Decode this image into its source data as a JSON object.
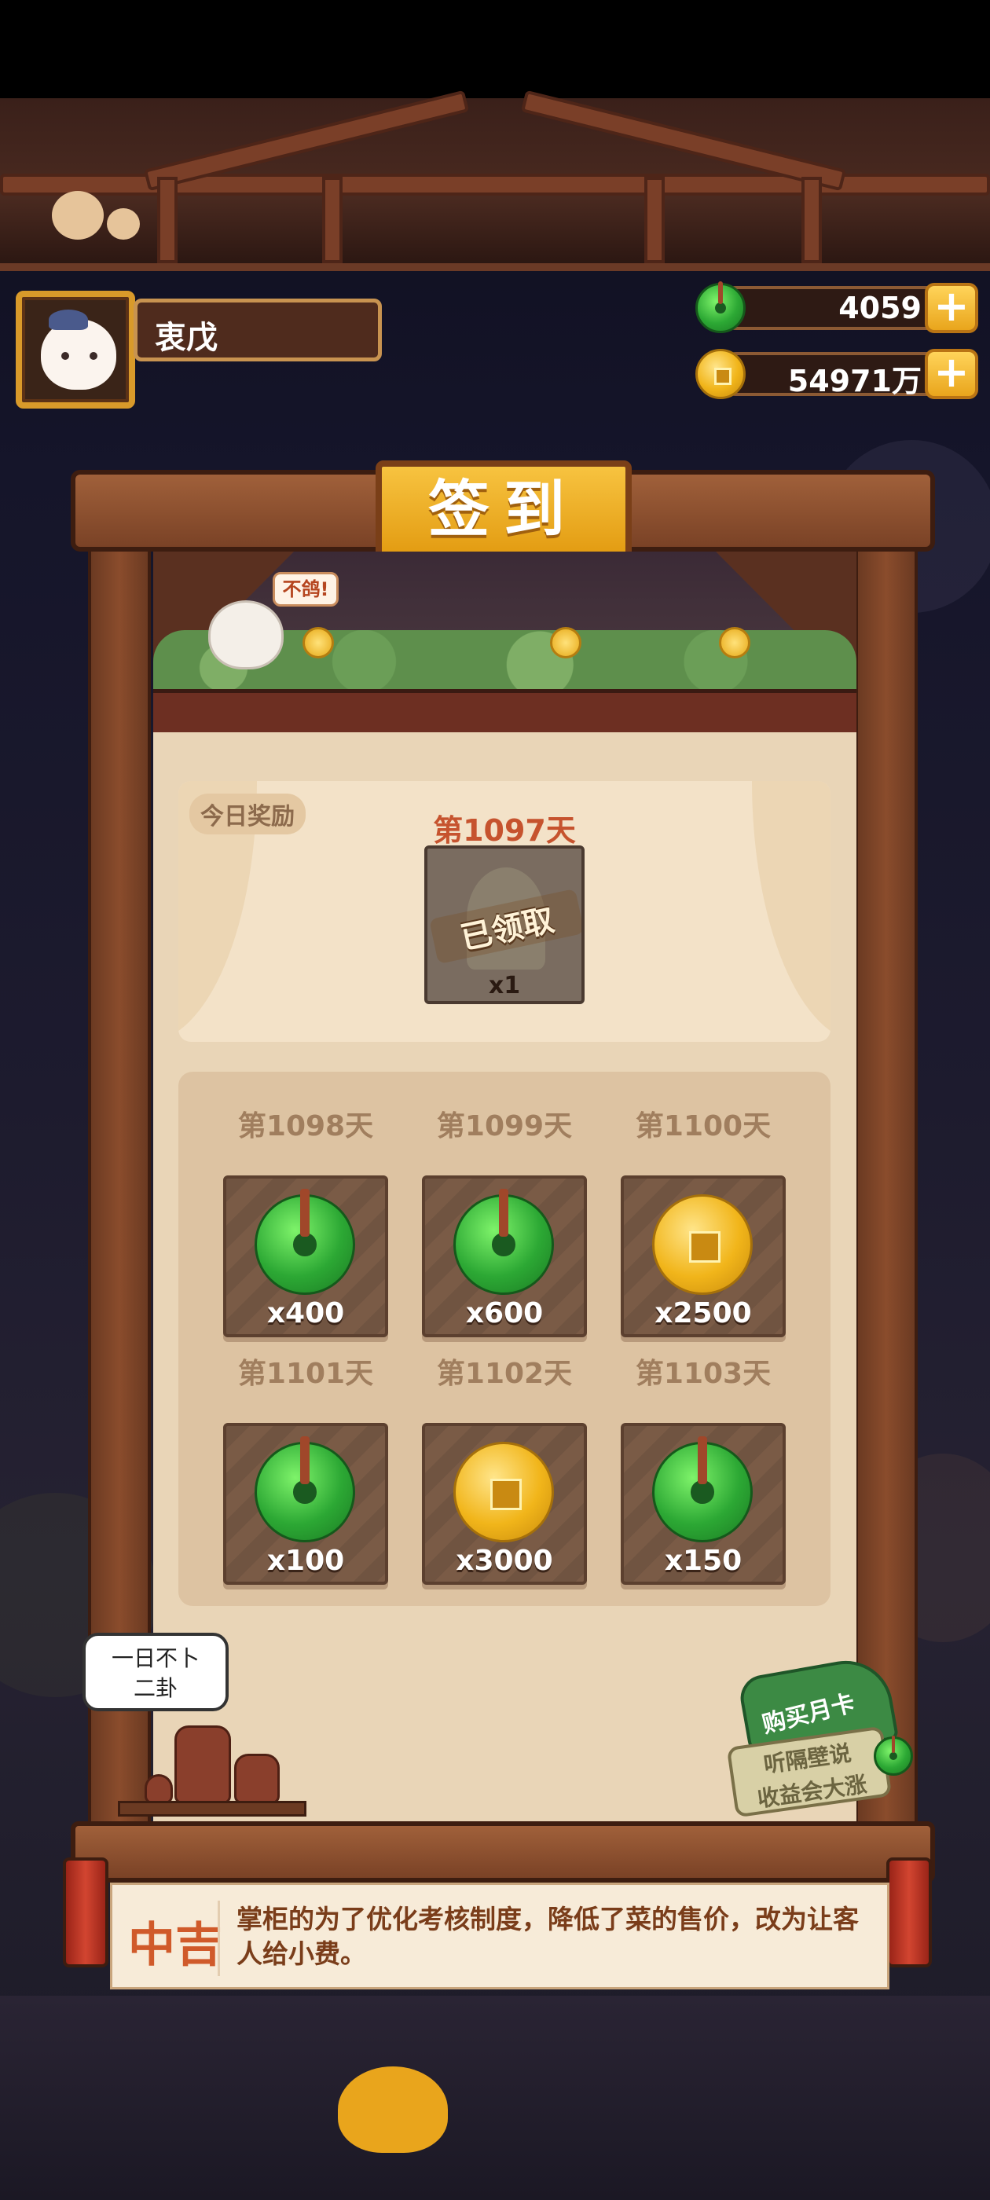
{
  "player": {
    "name": "衷戊"
  },
  "currencies": [
    {
      "icon": "jade-icon",
      "value": "4059",
      "plus": "+"
    },
    {
      "icon": "coin-icon",
      "value": "54971万",
      "plus": "+"
    }
  ],
  "panel": {
    "title": "签到",
    "bird_bubble": "不鸽!",
    "today": {
      "tag": "今日奖励",
      "day": "第1097天",
      "status": "已领取",
      "qty": "x1"
    },
    "rewards": [
      {
        "day": "第1098天",
        "icon": "jade-icon",
        "amount": "x400"
      },
      {
        "day": "第1099天",
        "icon": "jade-icon",
        "amount": "x600"
      },
      {
        "day": "第1100天",
        "icon": "coin-icon",
        "amount": "x2500"
      },
      {
        "day": "第1101天",
        "icon": "jade-icon",
        "amount": "x100"
      },
      {
        "day": "第1102天",
        "icon": "coin-icon",
        "amount": "x3000"
      },
      {
        "day": "第1103天",
        "icon": "jade-icon",
        "amount": "x150"
      }
    ]
  },
  "fortune_bubble": {
    "line1": "一日不卜",
    "line2": "二卦"
  },
  "monthly_card": {
    "button": "购买月卡",
    "line1": "听隔壁说",
    "line2": "收益会大涨"
  },
  "fortune": {
    "grade": "中吉",
    "message": "掌柜的为了优化考核制度，降低了菜的售价，改为让客人给小费。"
  }
}
